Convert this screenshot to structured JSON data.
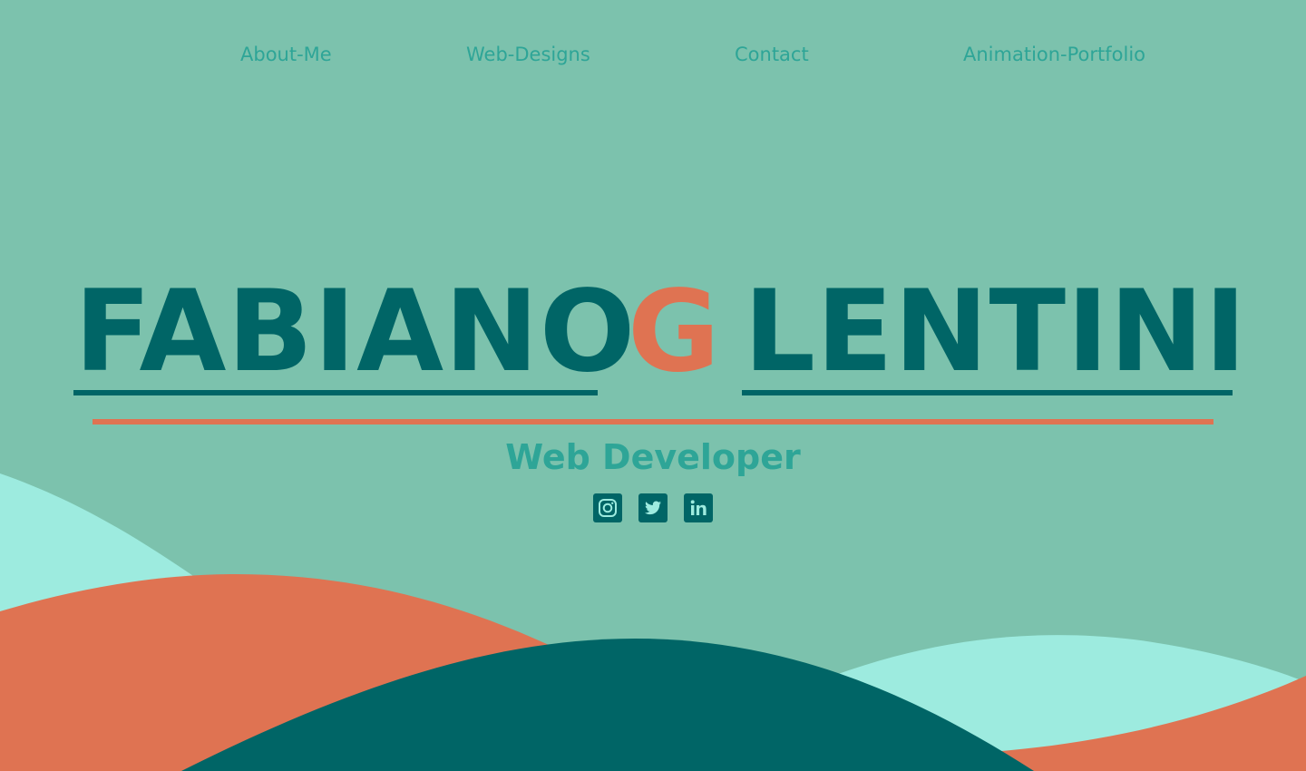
{
  "nav": {
    "about": "About-Me",
    "web_designs": "Web-Designs",
    "contact": "Contact",
    "animation": "Animation-Portfolio"
  },
  "hero": {
    "first_name": "FABIANO",
    "middle_initial": "G",
    "last_name": "LENTINI",
    "subtitle": "Web Developer"
  },
  "socials": [
    {
      "name": "instagram-icon"
    },
    {
      "name": "twitter-icon"
    },
    {
      "name": "linkedin-icon"
    }
  ],
  "colors": {
    "background": "#7cc2ad",
    "dark_teal": "#006566",
    "orange": "#df7352",
    "mint": "#9debdf",
    "accent_teal": "#2ea597"
  }
}
